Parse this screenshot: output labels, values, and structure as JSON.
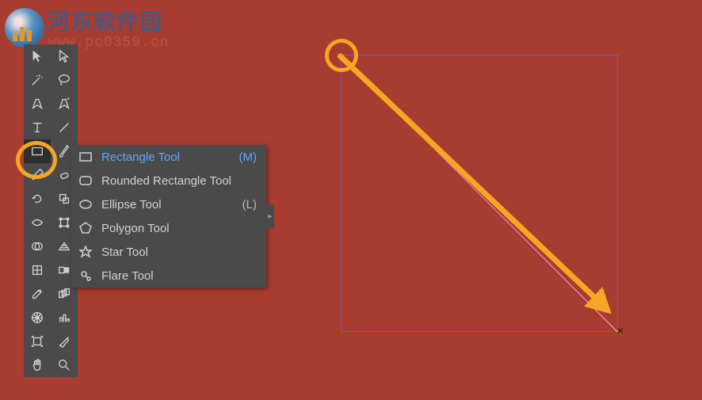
{
  "watermark": {
    "title": "河东软件园",
    "url": "www.pc0359.cn"
  },
  "flyout": {
    "items": [
      {
        "label": "Rectangle Tool",
        "shortcut": "(M)",
        "icon": "rectangle-icon",
        "selected": true
      },
      {
        "label": "Rounded Rectangle Tool",
        "shortcut": "",
        "icon": "rounded-rectangle-icon",
        "selected": false
      },
      {
        "label": "Ellipse Tool",
        "shortcut": "(L)",
        "icon": "ellipse-icon",
        "selected": false
      },
      {
        "label": "Polygon Tool",
        "shortcut": "",
        "icon": "polygon-icon",
        "selected": false
      },
      {
        "label": "Star Tool",
        "shortcut": "",
        "icon": "star-icon",
        "selected": false
      },
      {
        "label": "Flare Tool",
        "shortcut": "",
        "icon": "flare-icon",
        "selected": false
      }
    ],
    "expand_indicator": "▸"
  },
  "highlight_color": "#f5a623",
  "shape_outline_color": "#6a5acd",
  "canvas_bg": "#a83c30"
}
